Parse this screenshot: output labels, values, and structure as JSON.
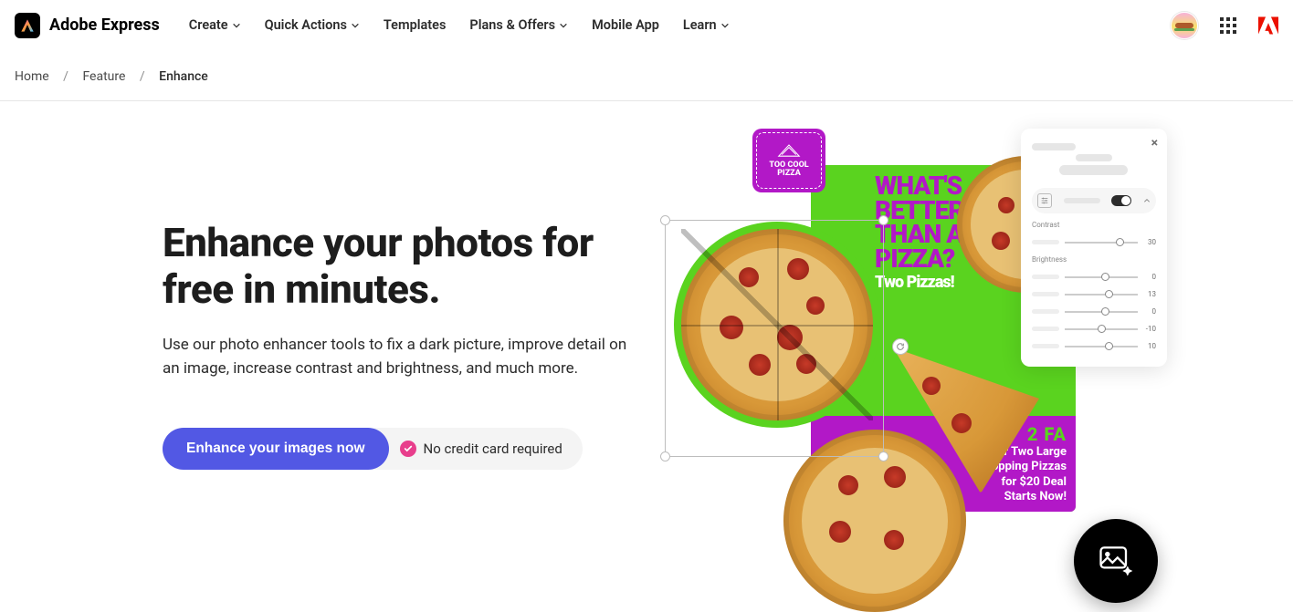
{
  "brand": "Adobe Express",
  "nav": {
    "create": "Create",
    "quick_actions": "Quick Actions",
    "templates": "Templates",
    "plans": "Plans & Offers",
    "mobile": "Mobile App",
    "learn": "Learn"
  },
  "breadcrumb": {
    "home": "Home",
    "feature": "Feature",
    "current": "Enhance"
  },
  "hero": {
    "title": "Enhance your photos for free in minutes.",
    "subtitle": "Use our photo enhancer tools to fix a dark picture, improve detail on an image, increase contrast and brightness, and much more.",
    "cta": "Enhance your images now",
    "note": "No credit card required"
  },
  "art": {
    "stamp_line1": "TOO COOL",
    "stamp_line2": "PIZZA",
    "headline": "WHAT'S\nBETTER\nTHAN A\nPIZZA?",
    "headline_sub": "Two Pizzas!",
    "promo_big": "2 FA",
    "promo_l1": "Our Two Large",
    "promo_l2": "2-Topping Pizzas",
    "promo_l3": "for $20 Deal",
    "promo_l4": "Starts Now!"
  },
  "panel": {
    "contrast_label": "Contrast",
    "brightness_label": "Brightness",
    "sliders": [
      {
        "value": "30",
        "pos": 70
      },
      {
        "value": "0",
        "pos": 50
      },
      {
        "value": "13",
        "pos": 55
      },
      {
        "value": "0",
        "pos": 50
      },
      {
        "value": "-10",
        "pos": 45
      },
      {
        "value": "10",
        "pos": 55
      }
    ]
  }
}
